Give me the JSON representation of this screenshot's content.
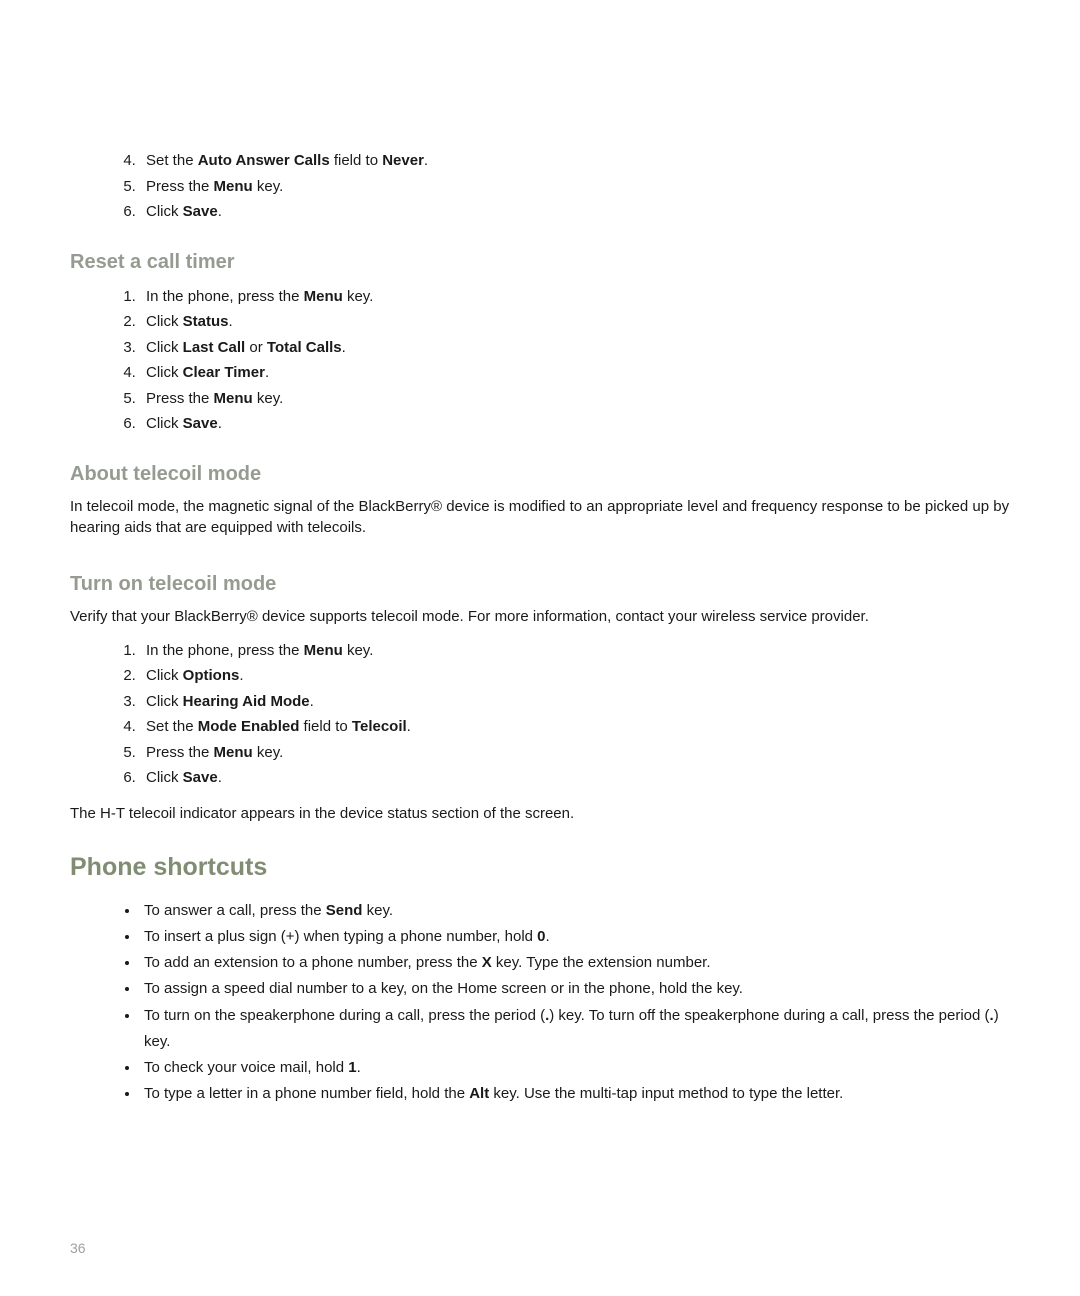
{
  "topList": {
    "start": 4,
    "items": [
      {
        "text": "Set the ",
        "b1": "Auto Answer Calls",
        "mid": " field to ",
        "b2": "Never",
        "tail": "."
      },
      {
        "text": "Press the ",
        "b1": "Menu",
        "tail": " key."
      },
      {
        "text": "Click ",
        "b1": "Save",
        "tail": "."
      }
    ]
  },
  "resetHeading": "Reset a call timer",
  "resetList": [
    {
      "text": "In the phone, press the ",
      "b1": "Menu",
      "tail": " key."
    },
    {
      "text": "Click ",
      "b1": "Status",
      "tail": "."
    },
    {
      "text": "Click ",
      "b1": "Last Call",
      "mid": " or ",
      "b2": "Total Calls",
      "tail": "."
    },
    {
      "text": "Click ",
      "b1": "Clear Timer",
      "tail": "."
    },
    {
      "text": "Press the ",
      "b1": "Menu",
      "tail": " key."
    },
    {
      "text": "Click ",
      "b1": "Save",
      "tail": "."
    }
  ],
  "aboutHeading": "About telecoil mode",
  "aboutPara": "In telecoil mode, the magnetic signal of the BlackBerry® device is modified to an appropriate level and frequency response to be picked up by hearing aids that are equipped with telecoils.",
  "turnOnHeading": "Turn on telecoil mode",
  "turnOnIntro": "Verify that your BlackBerry® device supports telecoil mode. For more information, contact your wireless service provider.",
  "turnOnList": [
    {
      "text": "In the phone, press the ",
      "b1": "Menu",
      "tail": " key."
    },
    {
      "text": "Click ",
      "b1": "Options",
      "tail": "."
    },
    {
      "text": "Click ",
      "b1": "Hearing Aid Mode",
      "tail": "."
    },
    {
      "text": "Set the ",
      "b1": "Mode Enabled",
      "mid": " field to ",
      "b2": "Telecoil",
      "tail": "."
    },
    {
      "text": "Press the ",
      "b1": "Menu",
      "tail": " key."
    },
    {
      "text": "Click ",
      "b1": "Save",
      "tail": "."
    }
  ],
  "turnOnOutro": "The H-T telecoil indicator appears in the device status section of the screen.",
  "shortcutsHeading": "Phone shortcuts",
  "shortcutsList": [
    {
      "text": "To answer a call, press the ",
      "b1": "Send",
      "tail": " key."
    },
    {
      "text": "To insert a plus sign (+) when typing a phone number, hold ",
      "b1": "0",
      "tail": "."
    },
    {
      "text": "To add an extension to a phone number, press the ",
      "b1": "X",
      "tail": " key. Type the extension number."
    },
    {
      "plain": "To assign a speed dial number to a key, on the Home screen or in the phone, hold the key."
    },
    {
      "text": "To turn on the speakerphone during a call, press the period (",
      "b1": ".",
      "mid": ") key. To turn off the speakerphone during a call, press the period (",
      "b2": ".",
      "tail": ") key."
    },
    {
      "text": "To check your voice mail, hold ",
      "b1": "1",
      "tail": "."
    },
    {
      "text": "To type a letter in a phone number field, hold the ",
      "b1": "Alt",
      "tail": " key. Use the multi-tap input method to type the letter."
    }
  ],
  "pageNumber": "36"
}
